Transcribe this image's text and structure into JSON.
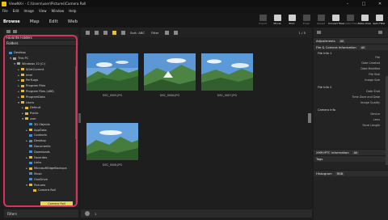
{
  "window": {
    "title": "ViewNX-i - C:\\Users\\user\\Pictures\\Camera Roll",
    "controls": [
      "–",
      "□",
      "✕"
    ]
  },
  "menu": [
    "File",
    "Edit",
    "Image",
    "View",
    "Window",
    "Help"
  ],
  "modes": [
    "Browse",
    "Map",
    "Edit",
    "Web"
  ],
  "toolbar": [
    {
      "label": "Import",
      "bright": false
    },
    {
      "label": "Movie",
      "bright": true
    },
    {
      "label": "Print",
      "bright": true
    },
    {
      "label": "Email",
      "bright": false
    },
    {
      "label": "Upload",
      "bright": false
    },
    {
      "label": "Convert Files",
      "bright": true
    },
    {
      "label": "Control Shoot",
      "bright": false
    },
    {
      "label": "Slide show",
      "bright": true
    },
    {
      "label": "Auto Filter",
      "bright": true
    }
  ],
  "left_panel": {
    "favorite_folders": "Favorite Folders",
    "folders": "Folders",
    "tree": [
      {
        "indent": 0,
        "label": "Desktop",
        "color": "blue",
        "tw": ""
      },
      {
        "indent": 1,
        "label": "This PC",
        "color": "grey",
        "tw": "▼"
      },
      {
        "indent": 2,
        "label": "Windows 10 (C:)",
        "color": "grey",
        "tw": "▼"
      },
      {
        "indent": 3,
        "label": "$GetCurrent",
        "color": "yellow",
        "tw": "►"
      },
      {
        "indent": 3,
        "label": "Intel",
        "color": "yellow",
        "tw": "►"
      },
      {
        "indent": 3,
        "label": "PerfLogs",
        "color": "yellow",
        "tw": "►"
      },
      {
        "indent": 3,
        "label": "Program Files",
        "color": "yellow",
        "tw": "►"
      },
      {
        "indent": 3,
        "label": "Program Files (x86)",
        "color": "yellow",
        "tw": "►"
      },
      {
        "indent": 3,
        "label": "ProgramData",
        "color": "yellow",
        "tw": "►"
      },
      {
        "indent": 3,
        "label": "Users",
        "color": "yellow",
        "tw": "▼"
      },
      {
        "indent": 4,
        "label": "Default",
        "color": "yellow",
        "tw": "►"
      },
      {
        "indent": 4,
        "label": "Public",
        "color": "yellow",
        "tw": "►"
      },
      {
        "indent": 4,
        "label": "user",
        "color": "yellow",
        "tw": "▼"
      },
      {
        "indent": 5,
        "label": "3D Objects",
        "color": "blue",
        "tw": ""
      },
      {
        "indent": 5,
        "label": "AppData",
        "color": "yellow",
        "tw": "►"
      },
      {
        "indent": 5,
        "label": "Contacts",
        "color": "blue",
        "tw": ""
      },
      {
        "indent": 5,
        "label": "Desktop",
        "color": "blue",
        "tw": "►"
      },
      {
        "indent": 5,
        "label": "Documents",
        "color": "blue",
        "tw": ""
      },
      {
        "indent": 5,
        "label": "Downloads",
        "color": "blue",
        "tw": ""
      },
      {
        "indent": 5,
        "label": "Favorites",
        "color": "yellow",
        "tw": "►"
      },
      {
        "indent": 5,
        "label": "Links",
        "color": "blue",
        "tw": ""
      },
      {
        "indent": 5,
        "label": "MicrosoftEdgeBackups",
        "color": "yellow",
        "tw": "►"
      },
      {
        "indent": 5,
        "label": "Music",
        "color": "blue",
        "tw": ""
      },
      {
        "indent": 5,
        "label": "OneDrive",
        "color": "blue",
        "tw": ""
      },
      {
        "indent": 5,
        "label": "Pictures",
        "color": "yellow",
        "tw": "▼"
      },
      {
        "indent": 6,
        "label": "Camera Roll",
        "color": "yellow",
        "tw": ""
      }
    ],
    "filters": "Filters"
  },
  "center": {
    "sort_label": "Sort: ABC",
    "filter_label": "Filter",
    "count": "1 / 5",
    "bottom_count": "1",
    "thumbnails": [
      {
        "file": "DSC_0005.JPG"
      },
      {
        "file": "DSC_0006.JPG"
      },
      {
        "file": "DSC_0007.JPG"
      },
      {
        "file": "DSC_0008.JPG"
      }
    ]
  },
  "right_panel": {
    "adjustments": "Adjustments",
    "adjustments_value": "All",
    "file_camera": "File & Camera Information",
    "file_camera_value": "All",
    "file_info_1": "File Info 1",
    "file_info_1_keys": [
      "File",
      "Date Created",
      "Date Modified",
      "File Size",
      "Image Size"
    ],
    "file_info_2": "File Info 2",
    "file_info_2_keys": [
      "Date Shot",
      "Time Zone and Date",
      "Image Quality"
    ],
    "camera_info": "Camera Info",
    "camera_info_keys": [
      "Device",
      "Lens",
      "Focal Length"
    ],
    "xmp": "XMP/IPTC Information",
    "xmp_value": "All",
    "tags": "Tags",
    "histogram": "Histogram",
    "histogram_value": "RGB"
  }
}
